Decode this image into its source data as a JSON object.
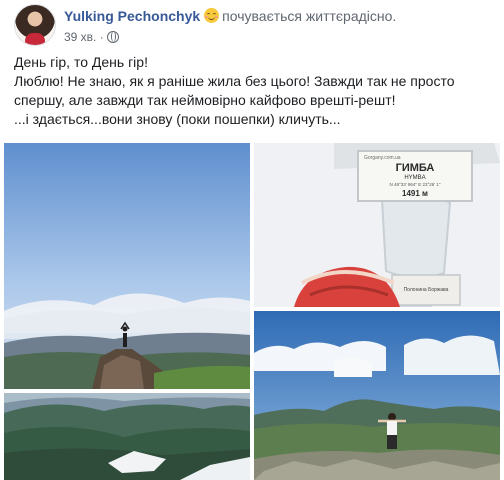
{
  "post": {
    "author": "Yulking Pechonchyk",
    "feeling_emoji": "smiling-face-with-smiling-eyes-icon",
    "feeling": "почувається життєрадісно.",
    "time": "39 хв.",
    "separator": "·",
    "privacy_icon": "globe-icon",
    "text_lines": [
      "День гір, то День гір!",
      "Люблю! Не знаю, як я раніше жила без цього! Завжди так не просто",
      "спершу, але завжди так неймовірно кайфово врешті-решт!",
      "...і здається...вони знову (поки пошепки) кличуть..."
    ]
  },
  "photos": {
    "sign_summit": "ГИМБА",
    "sign_summit_latin": "HYMBA",
    "sign_altitude": "1491 м",
    "sign_plate_small": "Gorgany.com.ua",
    "sign_coords": "N 48°33' 964\" E 23°26' 1\"",
    "sign_lower_text": "Полонина Боржава"
  },
  "colors": {
    "link": "#385898",
    "secondary_text": "#606770",
    "text": "#1c1e21"
  }
}
